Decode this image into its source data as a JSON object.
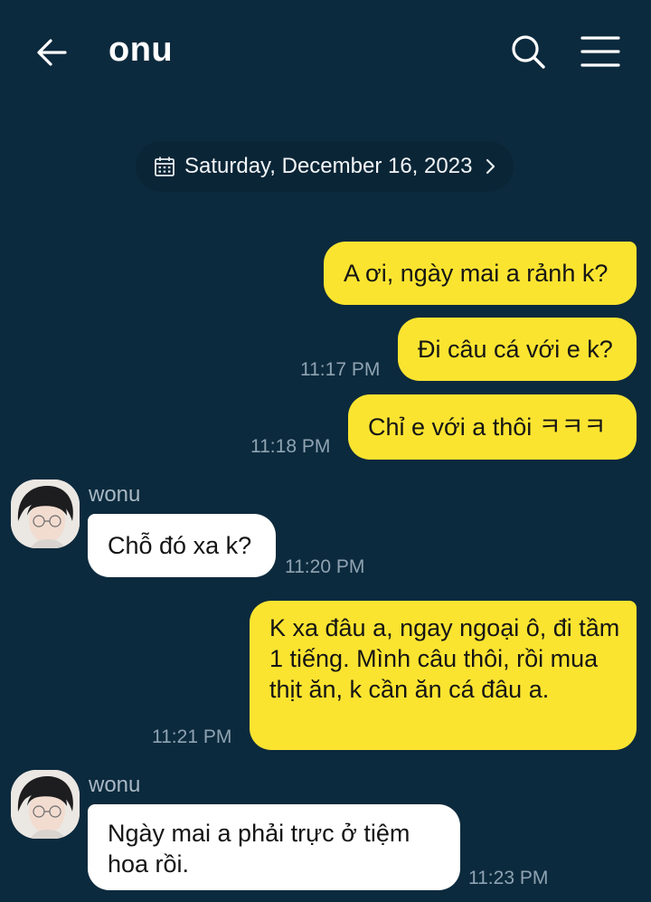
{
  "header": {
    "title": "onu",
    "back_icon": "arrow-left-icon",
    "search_icon": "search-icon",
    "menu_icon": "hamburger-menu-icon"
  },
  "date_pill": {
    "label": "Saturday, December 16, 2023",
    "icon": "calendar-icon"
  },
  "messages": [
    {
      "from": "me",
      "text": "A ơi, ngày mai a rảnh k?",
      "time": ""
    },
    {
      "from": "me",
      "text": "Đi câu cá với e k?",
      "time": "11:17 PM"
    },
    {
      "from": "me",
      "text": "Chỉ e với a thôi ㅋㅋㅋ",
      "time": "11:18 PM"
    },
    {
      "from": "other",
      "sender": "wonu",
      "text": "Chỗ đó xa k?",
      "time": "11:20 PM"
    },
    {
      "from": "me",
      "text": "K xa đâu a, ngay ngoại ô, đi tầm 1 tiếng. Mình câu thôi, rồi mua thịt ăn, k cần ăn cá đâu a.",
      "time": "11:21 PM"
    },
    {
      "from": "other",
      "sender": "wonu",
      "text": "Ngày mai a phải trực ở tiệm hoa rồi.",
      "time": "11:23 PM"
    }
  ],
  "colors": {
    "background": "#0c2a3d",
    "my_bubble": "#fbe430",
    "their_bubble": "#ffffff",
    "time_text": "#8fa3b2"
  }
}
